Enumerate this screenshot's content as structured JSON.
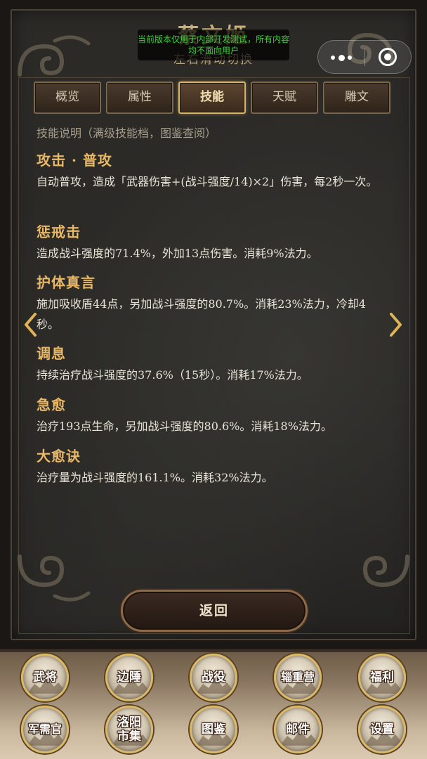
{
  "header": {
    "hero_name": "蔡文姬",
    "hero_hint": "左右滑动切换",
    "notice": "当前版本仅用于内部开发测试，所有内容均不面向用户"
  },
  "tabs": [
    {
      "label": "概览",
      "active": false
    },
    {
      "label": "属性",
      "active": false
    },
    {
      "label": "技能",
      "active": true
    },
    {
      "label": "天赋",
      "active": false
    },
    {
      "label": "雕文",
      "active": false
    }
  ],
  "content": {
    "caption": "技能说明（满级技能档，图鉴查阅）",
    "skills": [
      {
        "name": "攻击 · 普攻",
        "desc": "自动普攻，造成「武器伤害+(战斗强度/14)×2」伤害，每2秒一次。"
      },
      {
        "name": "惩戒击",
        "desc": "造成战斗强度的71.4%，外加13点伤害。消耗9%法力。"
      },
      {
        "name": "护体真言",
        "desc": "施加吸收盾44点，另加战斗强度的80.7%。消耗23%法力，冷却4秒。"
      },
      {
        "name": "调息",
        "desc": "持续治疗战斗强度的37.6%（15秒）。消耗17%法力。"
      },
      {
        "name": "急愈",
        "desc": "治疗193点生命，另加战斗强度的80.6%。消耗18%法力。"
      },
      {
        "name": "大愈诀",
        "desc": "治疗量为战斗强度的161.1%。消耗32%法力。"
      }
    ]
  },
  "return_label": "返回",
  "nav": {
    "row1": [
      "武将",
      "边陲",
      "战役",
      "辎重营",
      "福利"
    ],
    "row2": [
      "军需官",
      "洛阳市集",
      "图鉴",
      "邮件",
      "设置"
    ]
  },
  "colors": {
    "accent_gold": "#d7b56a",
    "skill_name": "#e8b867",
    "notice_green": "#3fd23f"
  }
}
